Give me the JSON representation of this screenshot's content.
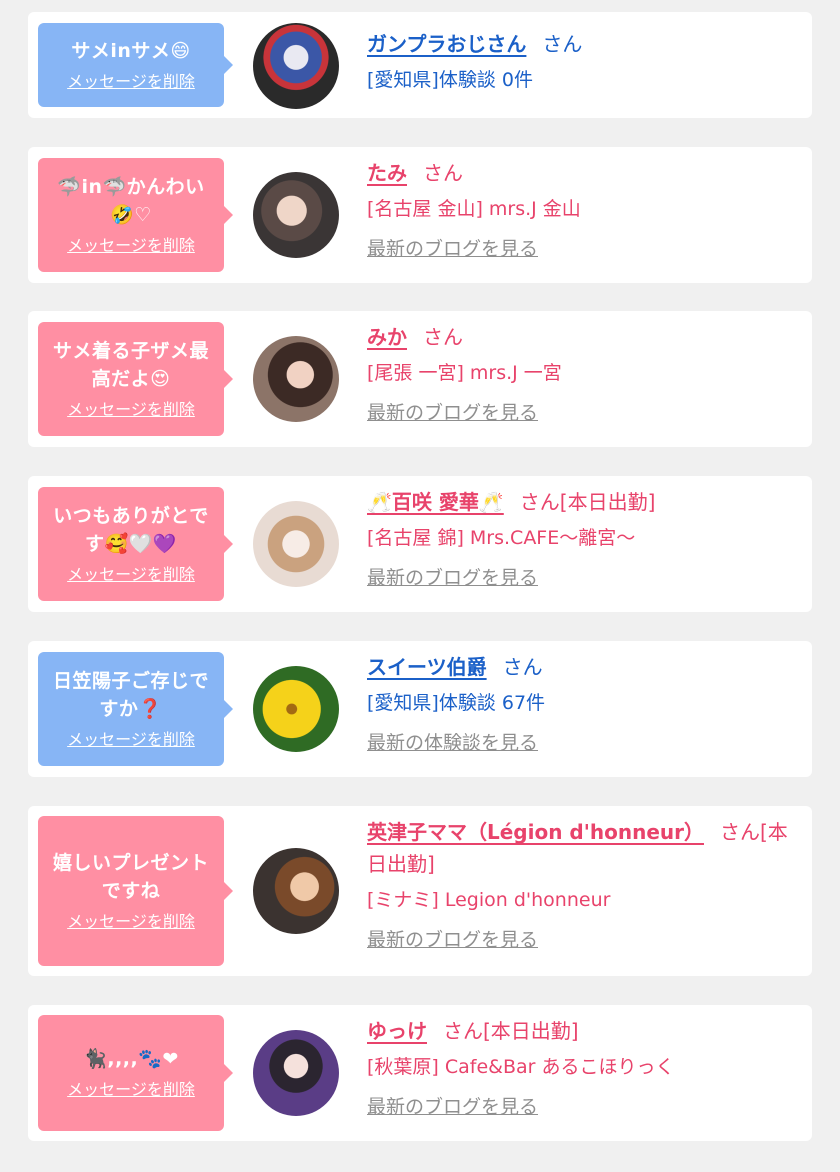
{
  "colors": {
    "pink_bubble": "#ff8fa3",
    "blue_bubble": "#87b5f5",
    "pink_text": "#e8436b",
    "blue_text": "#1b60c8",
    "link_gray": "#8f8f8f"
  },
  "delete_label": "メッセージを削除",
  "cards": [
    {
      "color": "blue",
      "message": "サメinサメ😄",
      "name": "ガンプラおじさん",
      "san": "さん",
      "sub": "[愛知県]体験談 0件",
      "link": "",
      "avatar_icon": "gundam-figure-avatar"
    },
    {
      "color": "pink",
      "message": "🦈in🦈かんわい🤣♡",
      "name": "たみ",
      "san": "さん",
      "sub": "[名古屋 金山] mrs.J 金山",
      "link": "最新のブログを見る",
      "avatar_icon": "woman-photo-avatar"
    },
    {
      "color": "pink",
      "message": "サメ着る子ザメ最高だよ😍",
      "name": "みか",
      "san": "さん",
      "sub": "[尾張 一宮] mrs.J 一宮",
      "link": "最新のブログを見る",
      "avatar_icon": "woman-photo-avatar"
    },
    {
      "color": "pink",
      "message": "いつもありがとです🥰🤍💜",
      "name": "🥂百咲 愛華🥂",
      "san": "さん[本日出勤]",
      "sub": "[名古屋 錦] Mrs.CAFE〜離宮〜",
      "link": "最新のブログを見る",
      "avatar_icon": "woman-photo-avatar"
    },
    {
      "color": "blue",
      "message": "日笠陽子ご存じですか❓",
      "name": "スイーツ伯爵",
      "san": "さん",
      "sub": "[愛知県]体験談 67件",
      "link": "最新の体験談を見る",
      "avatar_icon": "yellow-flower-avatar"
    },
    {
      "color": "pink",
      "message": "嬉しいプレゼントですね",
      "name": "英津子ママ（Légion d'honneur）",
      "san": "さん[本日出勤]",
      "sub": "[ミナミ] Legion d'honneur",
      "link": "最新のブログを見る",
      "avatar_icon": "woman-photo-avatar"
    },
    {
      "color": "pink",
      "message": "🐈‍⬛,,,,🐾❤",
      "name": "ゆっけ",
      "san": "さん[本日出勤]",
      "sub": "[秋葉原] Cafe&Bar あるこほりっく",
      "link": "最新のブログを見る",
      "avatar_icon": "woman-photo-avatar"
    }
  ]
}
